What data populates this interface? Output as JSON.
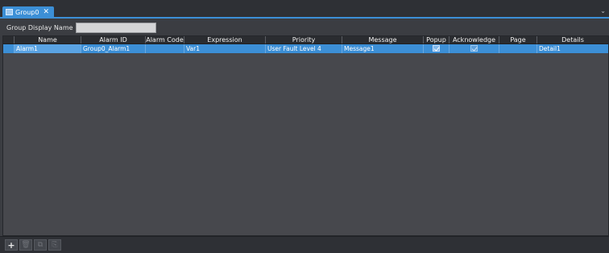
{
  "tab": {
    "label": "Group0",
    "close": "✕",
    "collapse": "⌄"
  },
  "group_display_name": {
    "label": "Group Display Name",
    "value": "",
    "placeholder": ""
  },
  "table": {
    "columns": [
      "",
      "Name",
      "Alarm ID",
      "Alarm Code",
      "Expression",
      "Priority",
      "Message",
      "Popup",
      "Acknowledge",
      "Page",
      "Details"
    ],
    "rows": [
      {
        "name": "Alarm1",
        "alarm_id": "Group0_Alarm1",
        "alarm_code": "",
        "expression": "Var1",
        "priority": "User Fault Level 4",
        "message": "Message1",
        "popup": true,
        "acknowledge": true,
        "page": "",
        "details": "Detail1"
      }
    ]
  },
  "toolbar": {
    "add": "+",
    "delete": "🗑",
    "copy": "⧉",
    "paste": "⎘"
  }
}
